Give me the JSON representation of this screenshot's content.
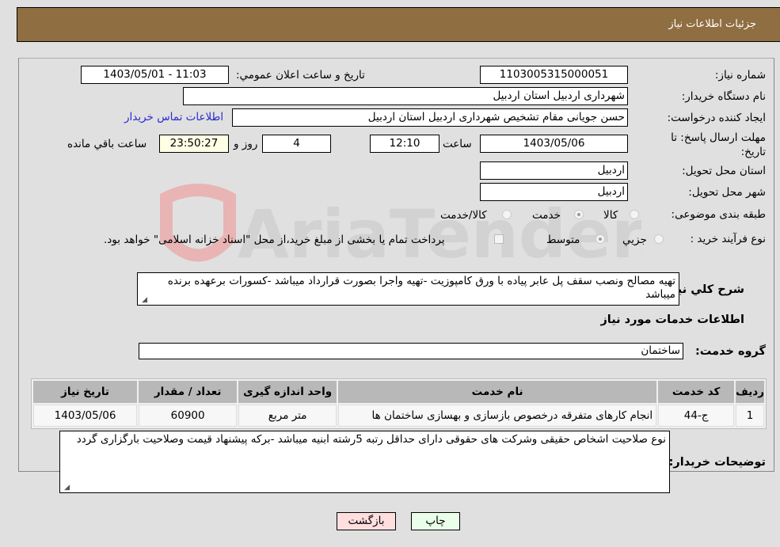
{
  "header": {
    "title": "جزئیات اطلاعات نیاز"
  },
  "form": {
    "need_number": {
      "label": "شماره نیاز:",
      "value": "1103005315000051"
    },
    "announce_datetime": {
      "label": "تاریخ و ساعت اعلان عمومي:",
      "value": "1403/05/01 - 11:03"
    },
    "buyer_org": {
      "label": "نام دستگاه خریدار:",
      "value": "شهرداری اردبیل استان اردبیل"
    },
    "requester": {
      "label": "ایجاد کننده درخواست:",
      "value": "حسن جویانی مقام تشخیص شهرداری اردبیل استان اردبیل"
    },
    "contact_link": "اطلاعات تماس خریدار",
    "deadline": {
      "label": "مهلت ارسال پاسخ: تا تاریخ:",
      "date": "1403/05/06",
      "time_label": "ساعت",
      "time": "12:10",
      "days": "4",
      "days_label": "روز و",
      "remaining": "23:50:27",
      "remaining_label": "ساعت باقي مانده"
    },
    "province": {
      "label": "استان محل تحویل:",
      "value": "اردبیل"
    },
    "city": {
      "label": "شهر محل تحویل:",
      "value": "اردبیل"
    },
    "category": {
      "label": "طبقه بندی موضوعی:",
      "options": [
        "کالا",
        "خدمت",
        "کالا/خدمت"
      ],
      "selected": "خدمت"
    },
    "purchase_type": {
      "label": "نوع فرآیند خرید :",
      "options": [
        "جزيي",
        "متوسط"
      ],
      "selected": "متوسط",
      "treasury_note": "پرداخت تمام یا بخشی از مبلغ خرید،از محل \"اسناد خزانه اسلامی\" خواهد بود."
    },
    "description": {
      "label": "شرح کلي نیاز:",
      "value": "تهیه مصالح ونصب سقف پل عابر پیاده با ورق کامپوزیت -تهیه واجرا بصورت قرارداد میباشد -کسورات برعهده برنده میباشد"
    },
    "services_section_title": "اطلاعات خدمات مورد نیاز",
    "service_group": {
      "label": "گروه خدمت:",
      "value": "ساختمان"
    },
    "table": {
      "headers": [
        "ردیف",
        "کد خدمت",
        "نام خدمت",
        "واحد اندازه گیری",
        "تعداد / مقدار",
        "تاریخ نیاز"
      ],
      "rows": [
        [
          "1",
          "ج-44",
          "انجام کارهای متفرقه درخصوص بازسازی و بهسازی ساختمان ها",
          "متر مربع",
          "60900",
          "1403/05/06"
        ]
      ]
    },
    "buyer_notes": {
      "label": "توضیحات خریدار:",
      "value": "نوع صلاحیت اشخاص حقیقی وشرکت های حقوقی دارای حداقل رتبه 5رشته ابنیه میباشد -برکه پیشنهاد قیمت وصلاحیت بارگزاری گردد"
    }
  },
  "buttons": {
    "print": "چاپ",
    "back": "بازگشت"
  },
  "watermark": {
    "text": "AriaTender.neT"
  }
}
